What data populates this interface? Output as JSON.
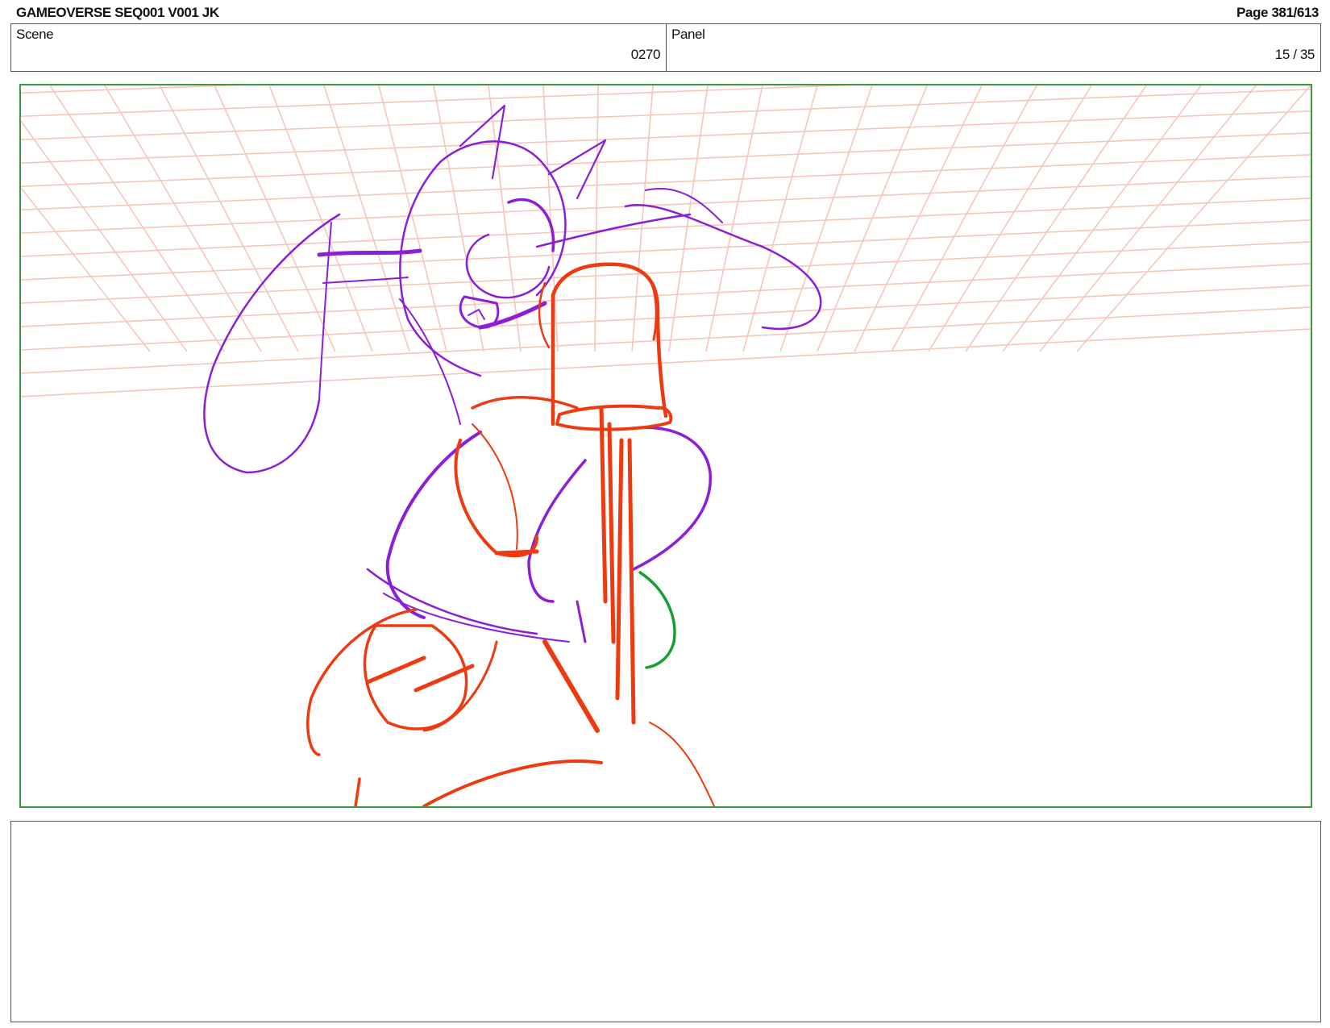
{
  "header": {
    "title": "GAMEOVERSE SEQ001 V001 JK",
    "page": "Page 381/613"
  },
  "info": {
    "scene_label": "Scene",
    "scene_value": "0270",
    "panel_label": "Panel",
    "panel_value": "15 / 35"
  },
  "frame": {
    "border_color": "#3f9a3f",
    "grid_color": "#f4c0b4",
    "sketch_colors": [
      "#8a1fd6",
      "#ee3a10",
      "#16a032"
    ]
  },
  "notes": {
    "text": ""
  }
}
